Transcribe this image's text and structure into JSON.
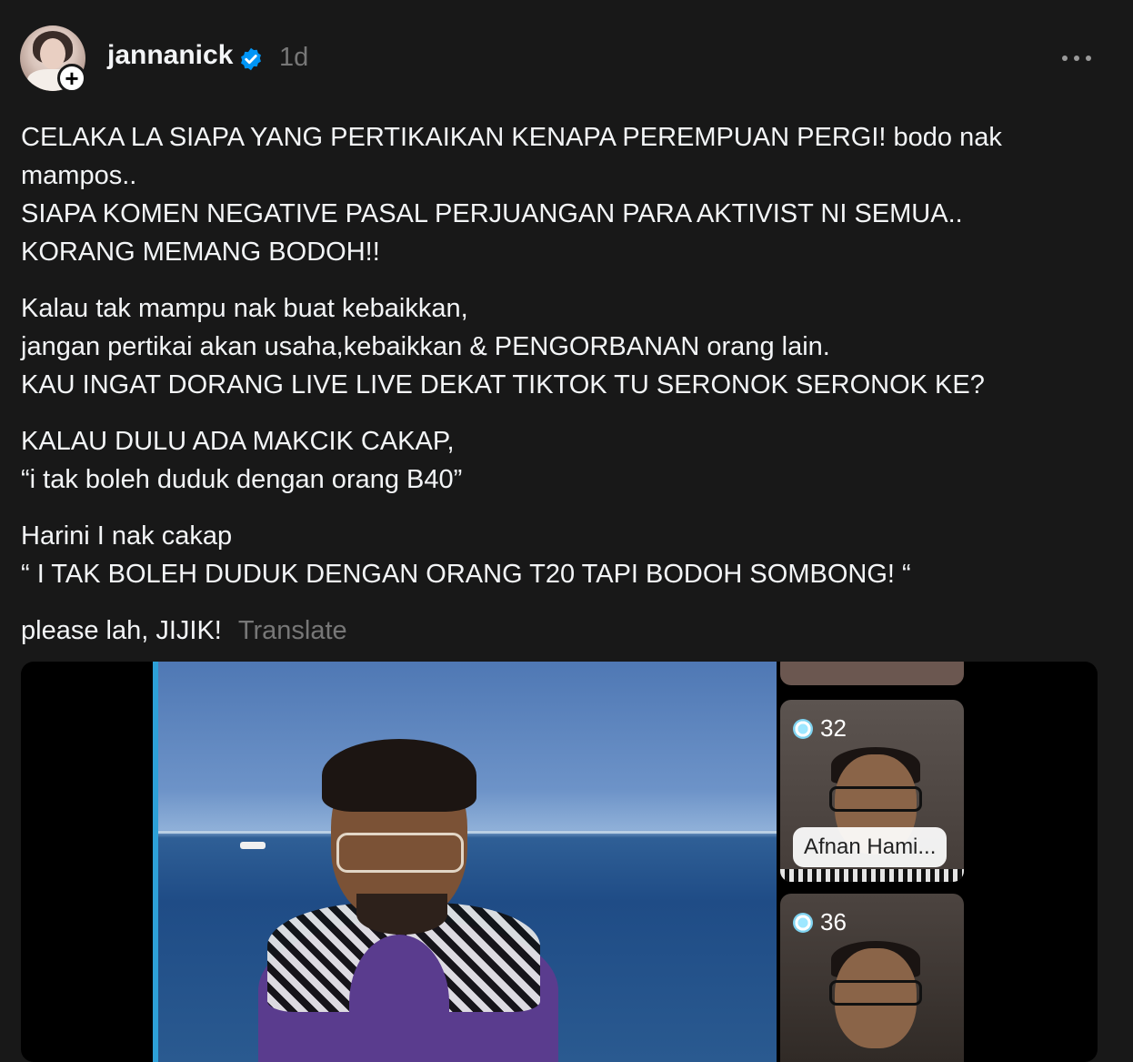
{
  "post": {
    "username": "jannanick",
    "time": "1d",
    "verified": true,
    "caption": {
      "paragraphs": [
        [
          "CELAKA LA SIAPA YANG PERTIKAIKAN KENAPA PEREMPUAN PERGI! bodo nak",
          "mampos..",
          "SIAPA KOMEN NEGATIVE PASAL PERJUANGAN PARA AKTIVIST NI SEMUA..",
          "KORANG MEMANG BODOH!!"
        ],
        [
          "Kalau tak mampu nak buat kebaikkan,",
          "jangan pertikai akan usaha,kebaikkan & PENGORBANAN orang lain.",
          "KAU INGAT DORANG LIVE LIVE DEKAT TIKTOK TU SERONOK SERONOK KE?"
        ],
        [
          "KALAU DULU ADA MAKCIK CAKAP,",
          "“i tak boleh duduk dengan orang B40”"
        ],
        [
          "Harini I nak cakap",
          "“ I TAK BOLEH DUDUK DENGAN ORANG T20 TAPI BODOH SOMBONG! “"
        ]
      ],
      "last_line": "please lah, JIJIK!",
      "translate_label": "Translate"
    }
  },
  "media": {
    "tiles": [
      {
        "badge_count": "32",
        "label": "Afnan Hami..."
      },
      {
        "badge_count": "36"
      }
    ]
  },
  "colors": {
    "background": "#181818",
    "text": "#f3f5f7",
    "muted": "#777777",
    "verified": "#0095f6"
  }
}
